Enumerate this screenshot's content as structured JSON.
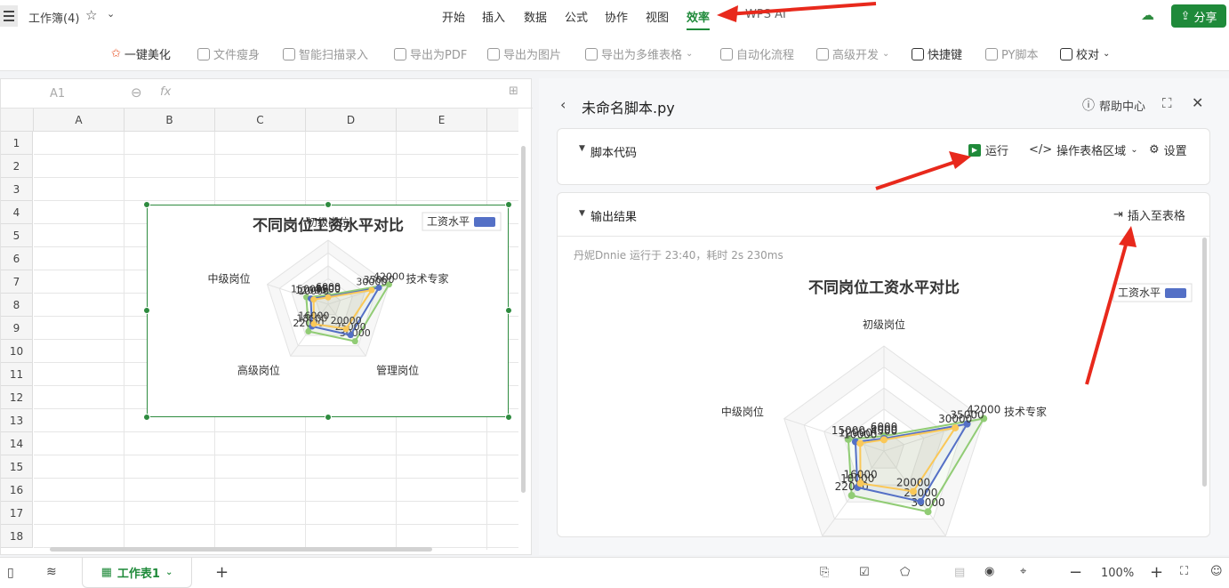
{
  "app": {
    "workbook_title": "工作簿(4)",
    "share_label": "分享"
  },
  "menu": {
    "tabs": [
      "开始",
      "插入",
      "数据",
      "公式",
      "协作",
      "视图",
      "效率",
      "WPS AI"
    ],
    "active": "效率"
  },
  "toolbar": {
    "beautify": "一键美化",
    "slim": "文件瘦身",
    "scan": "智能扫描录入",
    "pdf": "导出为PDF",
    "image": "导出为图片",
    "multi": "导出为多维表格",
    "auto": "自动化流程",
    "dev": "高级开发",
    "shortcut": "快捷键",
    "py": "PY脚本",
    "proof": "校对"
  },
  "formula": {
    "cell_ref": "A1",
    "fx": "fx"
  },
  "columns": [
    "A",
    "B",
    "C",
    "D",
    "E"
  ],
  "rows": [
    "1",
    "2",
    "3",
    "4",
    "5",
    "6",
    "7",
    "8",
    "9",
    "10",
    "11",
    "12",
    "13",
    "14",
    "15",
    "16",
    "17",
    "18"
  ],
  "sheet_tab": "工作表1",
  "zoom": "100%",
  "panel": {
    "title": "未命名脚本.py",
    "help": "帮助中心",
    "code_section": "脚本代码",
    "run": "运行",
    "area": "操作表格区域",
    "settings": "设置",
    "output_section": "输出结果",
    "insert": "插入至表格",
    "run_info": "丹妮Dnnie 运行于 23:40，耗时 2s 230ms"
  },
  "colors": {
    "accent": "#1f8a3a",
    "series_blue": "#5470c6",
    "series_green": "#91cc75",
    "series_yellow": "#fac858",
    "arrow": "#e8291c"
  },
  "chart_data": {
    "type": "radar",
    "title": "不同岗位工资水平对比",
    "legend": [
      "工资水平"
    ],
    "legend_position": "top-right",
    "categories": [
      "初级岗位",
      "技术专家",
      "管理岗位",
      "高级岗位",
      "中级岗位"
    ],
    "max": 42000,
    "series": [
      {
        "values": [
          6000,
          42000,
          30000,
          22000,
          15000
        ]
      },
      {
        "values": [
          5000,
          35000,
          25000,
          18000,
          12000
        ]
      },
      {
        "values": [
          4500,
          30000,
          20000,
          16000,
          10000
        ]
      }
    ]
  }
}
